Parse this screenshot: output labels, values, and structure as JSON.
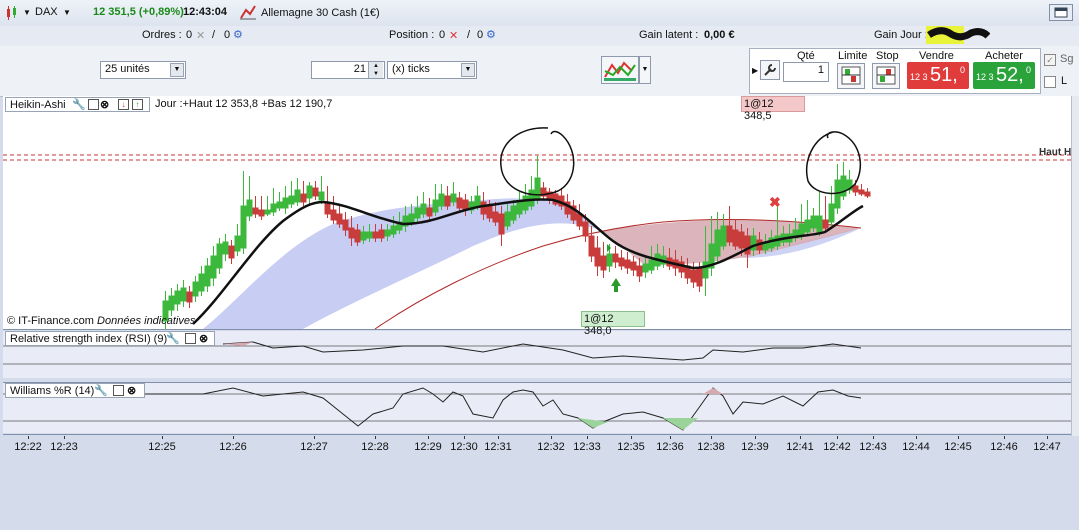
{
  "header": {
    "symbol": "DAX",
    "price_change": "12 351,5 (+0,89%)",
    "time": "12:43:04",
    "instrument": "Allemagne 30 Cash (1€)"
  },
  "orders_bar": {
    "ordres_label": "Ordres :",
    "ordres_a": "0",
    "ordres_b": "0",
    "position_label": "Position :",
    "position_a": "0",
    "position_b": "0",
    "gain_latent_label": "Gain latent :",
    "gain_latent_value": "0,00 €",
    "gain_jour_label": "Gain Jour :"
  },
  "toolbar": {
    "units_select": "25 unités",
    "period_value": "21",
    "period_unit": "(x) ticks",
    "qty_label": "Qté",
    "qty_value": "1",
    "limit_label": "Limite",
    "stop_label": "Stop",
    "sell_label": "Vendre",
    "buy_label": "Acheter",
    "sell_price_small": "12 3",
    "sell_price_big": "51,",
    "sell_price_sup": "0",
    "buy_price_small": "12 3",
    "buy_price_big": "52,",
    "buy_price_sup": "0",
    "sg_label": "Sg",
    "l_label": "L"
  },
  "main_chart": {
    "title": "Heikin-Ashi",
    "info": "Jour :+Haut 12 353,8 +Bas 12 190,7",
    "top_marker": "1@12 348,5",
    "bottom_marker": "1@12 348,0",
    "haut_label": "Haut H",
    "copyright": "© IT-Finance.com",
    "copyright_note": "Données indicatives"
  },
  "rsi_panel": {
    "title": "Relative strength index (RSI) (9)"
  },
  "williams_panel": {
    "title": "Williams %R (14)"
  },
  "time_axis": [
    "12:22",
    "12:23",
    "12:25",
    "12:26",
    "12:27",
    "12:28",
    "12:29",
    "12:30",
    "12:31",
    "12:32",
    "12:33",
    "12:35",
    "12:36",
    "12:38",
    "12:39",
    "12:41",
    "12:42",
    "12:43",
    "12:44",
    "12:45",
    "12:46",
    "12:47"
  ],
  "colors": {
    "up": "#3cb83c",
    "down": "#c83c3c",
    "sell": "#e03c3c",
    "buy": "#29a33a",
    "cloud_blue": "#b9c0f0",
    "cloud_red": "#d6a8b0"
  }
}
